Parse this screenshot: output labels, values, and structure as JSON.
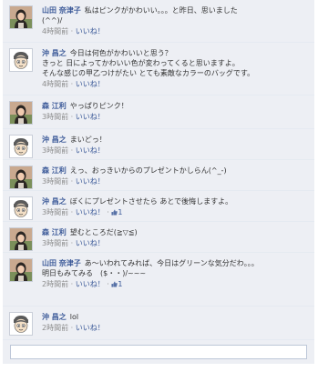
{
  "comments": [
    {
      "avatar": "woman-photo",
      "name": "山田 奈津子",
      "lines": [
        "私はピンクがかわいい。。。と昨日、思いました",
        "(^^)/"
      ],
      "time": "4時間前",
      "like_label": "いいね！",
      "likes": ""
    },
    {
      "avatar": "cartoon-face",
      "name": "沖 昌之",
      "lines": [
        "今日は何色がかわいいと思う？",
        "きっと 日によってかわいい色が変わってくると思いますよ。",
        "そんな感じの甲乙つけがたい とても素敵なカラーのバッグです。"
      ],
      "time": "4時間前",
      "like_label": "いいね！",
      "likes": ""
    },
    {
      "avatar": "woman-photo",
      "name": "森 江利",
      "lines": [
        "やっぱりピンク！"
      ],
      "time": "3時間前",
      "like_label": "いいね！",
      "likes": ""
    },
    {
      "avatar": "cartoon-face",
      "name": "沖 昌之",
      "lines": [
        "まいどっ！"
      ],
      "time": "3時間前",
      "like_label": "いいね！",
      "likes": ""
    },
    {
      "avatar": "woman-photo",
      "name": "森 江利",
      "lines": [
        "えっ、おっきいからのプレゼントかしらん(^_-)"
      ],
      "time": "3時間前",
      "like_label": "いいね！",
      "likes": ""
    },
    {
      "avatar": "cartoon-face",
      "name": "沖 昌之",
      "lines": [
        "ぼくにプレゼントさせたら あとで後悔しますよ。"
      ],
      "time": "3時間前",
      "like_label": "いいね！",
      "likes": "1"
    },
    {
      "avatar": "woman-photo",
      "name": "森 江利",
      "lines": [
        "望むところだ(≧▽≦)"
      ],
      "time": "3時間前",
      "like_label": "いいね！",
      "likes": ""
    },
    {
      "avatar": "woman-photo",
      "name": "山田 奈津子",
      "lines": [
        "あ〜いわれてみれば、今日はグリーンな気分だわ。。。",
        "明日もみてみる　($・・)/~~~"
      ],
      "time": "2時間前",
      "like_label": "いいね！",
      "likes": "1"
    },
    {
      "avatar": "cartoon-face",
      "name": "沖 昌之",
      "lines": [
        "lol"
      ],
      "time": "2時間前",
      "like_label": "いいね！",
      "likes": ""
    }
  ],
  "comment_input": {
    "value": "",
    "placeholder": ""
  },
  "colors": {
    "link": "#3b5998",
    "background": "#edeff4",
    "meta": "#8c8c8c"
  }
}
